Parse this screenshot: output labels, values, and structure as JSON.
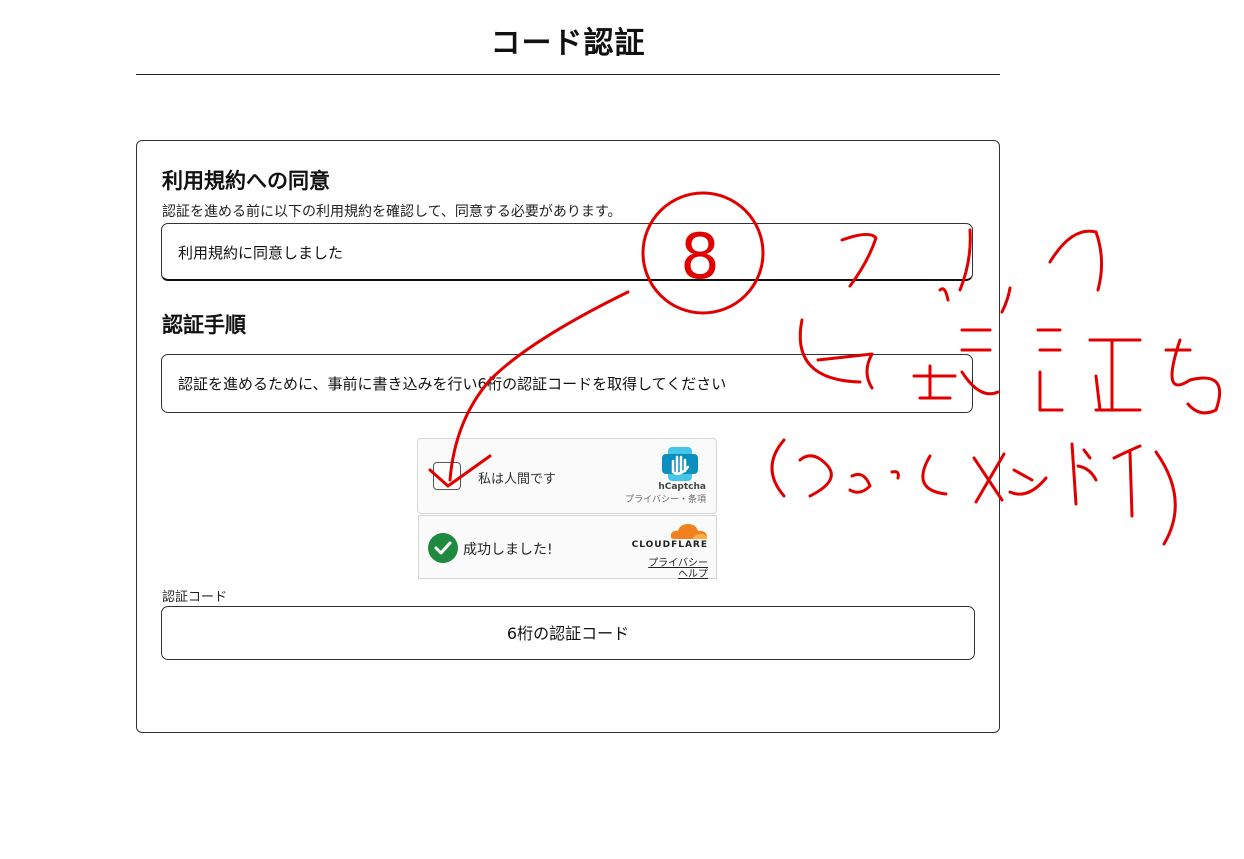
{
  "page": {
    "title": "コード認証"
  },
  "terms": {
    "heading": "利用規約への同意",
    "description": "認証を進める前に以下の利用規約を確認して、同意する必要があります。",
    "box_text": "利用規約に同意しました"
  },
  "steps": {
    "heading": "認証手順",
    "box_text": "認証を進めるために、事前に書き込みを行い6桁の認証コードを取得してください"
  },
  "hcaptcha": {
    "label": "私は人間です",
    "brand": "hCaptcha",
    "links": "プライバシー・条項"
  },
  "cloudflare": {
    "label": "成功しました!",
    "brand": "CLOUDFLARE",
    "privacy_link": "プライバシー",
    "help_link": "ヘルプ",
    "accent": "#f38020",
    "success_color": "#1f8a3f"
  },
  "code": {
    "label": "認証コード",
    "placeholder": "6桁の認証コード"
  },
  "annotation": {
    "circled_number": "8",
    "color": "#e10000"
  }
}
